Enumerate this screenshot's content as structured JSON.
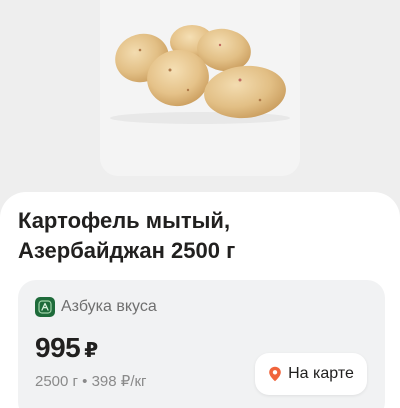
{
  "product": {
    "title_line1": "Картофель мытый,",
    "title_line2": "Азербайджан 2500 г",
    "image_icon": "potatoes-image"
  },
  "offer": {
    "store_name": "Азбука вкуса",
    "store_logo_icon": "azbuka-vkusa-logo-icon",
    "price": "995",
    "currency": "₽",
    "details": "2500 г • 398 ₽/кг",
    "map_button_label": "На карте",
    "map_button_icon": "location-pin-icon"
  },
  "colors": {
    "background": "#eeeeee",
    "card": "#f1f2f3",
    "store_logo": "#1e6b3a",
    "pin": "#f0643c",
    "text_primary": "#21201f",
    "text_secondary": "#8a8a8a"
  }
}
